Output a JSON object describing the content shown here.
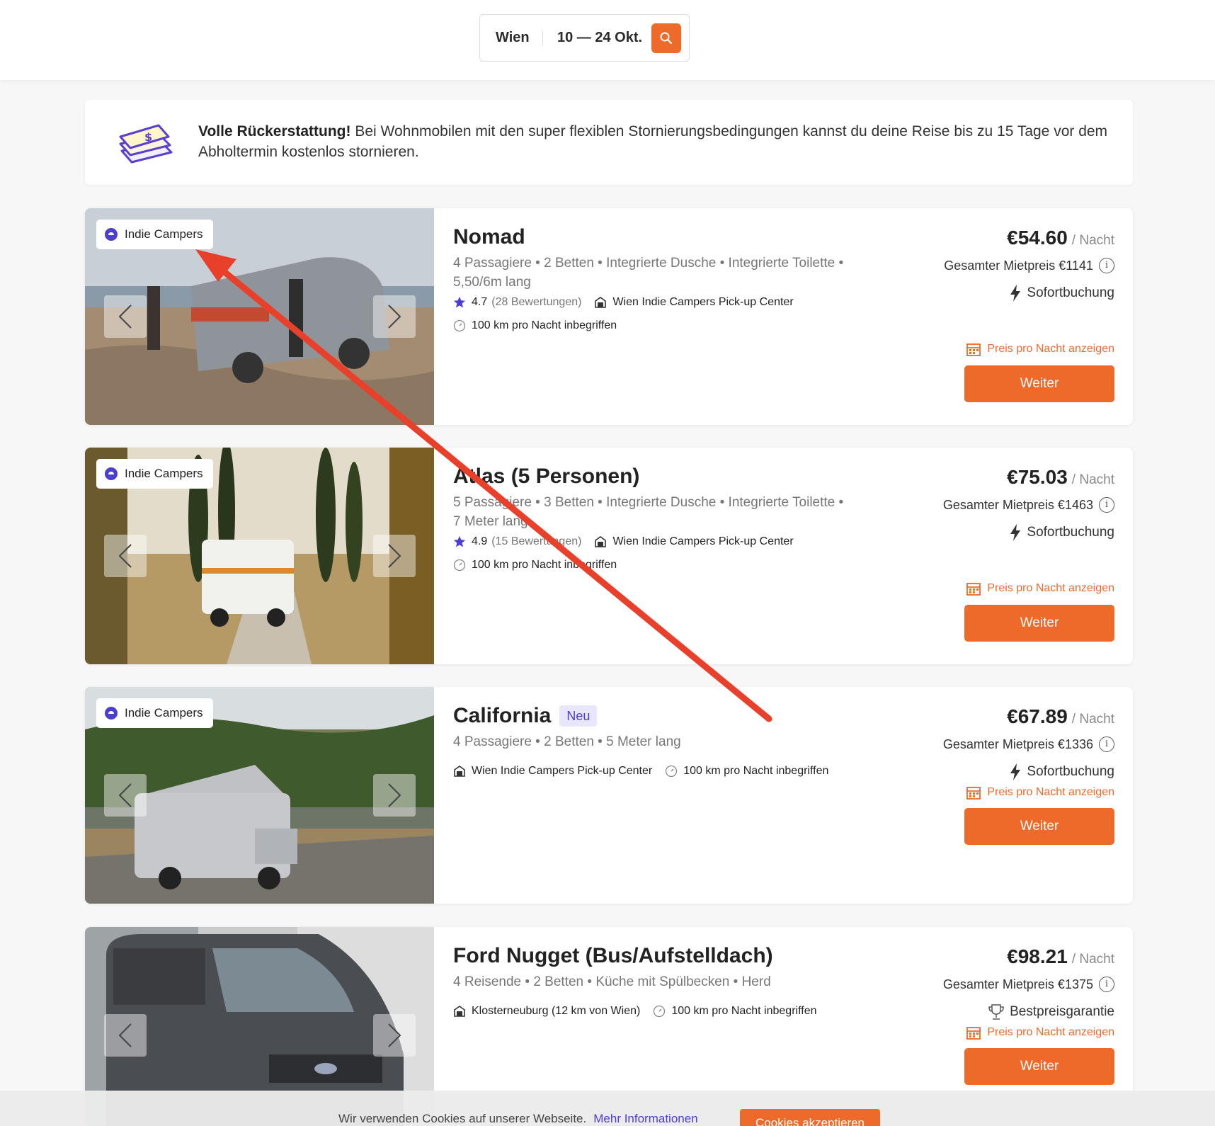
{
  "search": {
    "city": "Wien",
    "dates": "10 — 24 Okt."
  },
  "refund": {
    "title": "Volle Rückerstattung!",
    "text": "Bei Wohnmobilen mit den super flexiblen Stornierungsbedingungen kannst du deine Reise bis zu 15 Tage vor dem Abholtermin kostenlos stornieren."
  },
  "listings": [
    {
      "badge": "Indie Campers",
      "title": "Nomad",
      "features_line1": "4 Passagiere  •  2 Betten  •  Integrierte Dusche  •  Integrierte Toilette  •",
      "features_line2": "5,50/6m lang",
      "rating": "4.7",
      "reviews": "(28 Bewertungen)",
      "location": "Wien Indie Campers Pick-up Center",
      "mileage": "100 km pro Nacht inbegriffen",
      "price": "€54.60",
      "per_night": "/ Nacht",
      "total": "Gesamter Mietpreis €1141",
      "feature": "Sofortbuchung",
      "nightly_link": "Preis pro Nacht anzeigen",
      "button": "Weiter"
    },
    {
      "badge": "Indie Campers",
      "title": "Atlas (5 Personen)",
      "features_line1": "5 Passagiere  •  3 Betten  •  Integrierte Dusche  •  Integrierte Toilette  •",
      "features_line2": "7 Meter lang",
      "rating": "4.9",
      "reviews": "(15 Bewertungen)",
      "location": "Wien Indie Campers Pick-up Center",
      "mileage": "100 km pro Nacht inbegriffen",
      "price": "€75.03",
      "per_night": "/ Nacht",
      "total": "Gesamter Mietpreis €1463",
      "feature": "Sofortbuchung",
      "nightly_link": "Preis pro Nacht anzeigen",
      "button": "Weiter"
    },
    {
      "badge": "Indie Campers",
      "title": "California",
      "tag": "Neu",
      "features_line1": "4 Passagiere  •  2 Betten  •  5 Meter lang",
      "location": "Wien Indie Campers Pick-up Center",
      "mileage": "100 km pro Nacht inbegriffen",
      "price": "€67.89",
      "per_night": "/ Nacht",
      "total": "Gesamter Mietpreis €1336",
      "feature": "Sofortbuchung",
      "nightly_link": "Preis pro Nacht anzeigen",
      "button": "Weiter"
    },
    {
      "title": "Ford Nugget (Bus/Aufstelldach)",
      "features_line1": "4 Reisende  •  2 Betten  •  Küche mit Spülbecken  •  Herd",
      "location": "Klosterneuburg (12 km von Wien)",
      "mileage": "100 km pro Nacht inbegriffen",
      "price": "€98.21",
      "per_night": "/ Nacht",
      "total": "Gesamter Mietpreis €1375",
      "feature": "Bestpreisgarantie",
      "nightly_link": "Preis pro Nacht anzeigen",
      "button": "Weiter"
    }
  ],
  "cookie": {
    "text": "Wir verwenden Cookies auf unserer Webseite.",
    "link": "Mehr Informationen",
    "button": "Cookies akzeptieren"
  },
  "colors": {
    "accent": "#ee6a2b",
    "brand": "#4b3fd1",
    "annotation": "#e8402a"
  }
}
